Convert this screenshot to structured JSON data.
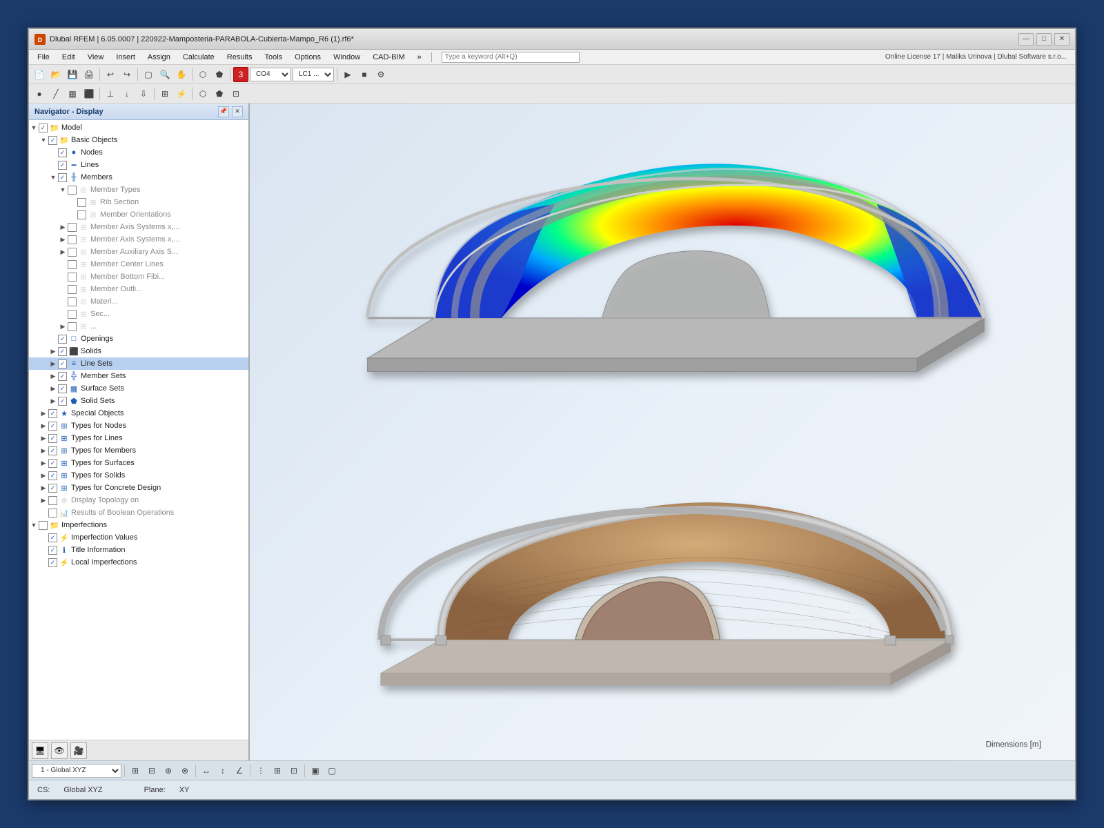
{
  "window": {
    "title": "Dlubal RFEM | 6.05.0007 | 220922-Mamposteria-PARABOLA-Cubierta-Mampo_R6 (1).rf6*",
    "app_icon": "D",
    "controls": [
      "—",
      "□",
      "✕"
    ]
  },
  "menu": {
    "items": [
      "File",
      "Edit",
      "View",
      "Insert",
      "Assign",
      "Calculate",
      "Results",
      "Tools",
      "Options",
      "Window",
      "CAD-BIM",
      "»"
    ],
    "search_placeholder": "Type a keyword (Alt+Q)",
    "license": "Online License 17 | Malika Urinova | Dlubal Software s.r.o..."
  },
  "navigator": {
    "title": "Navigator - Display",
    "tree": [
      {
        "id": "model",
        "label": "Model",
        "level": 0,
        "checked": true,
        "expanded": true,
        "hasExpander": true,
        "iconType": "folder"
      },
      {
        "id": "basic-objects",
        "label": "Basic Objects",
        "level": 1,
        "checked": true,
        "expanded": true,
        "hasExpander": true,
        "iconType": "folder"
      },
      {
        "id": "nodes",
        "label": "Nodes",
        "level": 2,
        "checked": true,
        "expanded": false,
        "hasExpander": false,
        "iconType": "node"
      },
      {
        "id": "lines",
        "label": "Lines",
        "level": 2,
        "checked": true,
        "expanded": false,
        "hasExpander": false,
        "iconType": "line"
      },
      {
        "id": "members",
        "label": "Members",
        "level": 2,
        "checked": true,
        "expanded": true,
        "hasExpander": true,
        "iconType": "member"
      },
      {
        "id": "member-types",
        "label": "Member Types",
        "level": 3,
        "checked": false,
        "expanded": true,
        "hasExpander": true,
        "iconType": "type"
      },
      {
        "id": "rib-section",
        "label": "Rib Section",
        "level": 4,
        "checked": false,
        "expanded": false,
        "hasExpander": false,
        "iconType": "type"
      },
      {
        "id": "member-orientations",
        "label": "Member Orientations",
        "level": 4,
        "checked": false,
        "expanded": false,
        "hasExpander": false,
        "iconType": "type"
      },
      {
        "id": "member-axis-x1",
        "label": "Member Axis Systems x,...",
        "level": 3,
        "checked": false,
        "expanded": false,
        "hasExpander": true,
        "iconType": "type"
      },
      {
        "id": "member-axis-x2",
        "label": "Member Axis Systems x,...",
        "level": 3,
        "checked": false,
        "expanded": false,
        "hasExpander": true,
        "iconType": "type"
      },
      {
        "id": "member-aux",
        "label": "Member Auxiliary Axis S...",
        "level": 3,
        "checked": false,
        "expanded": false,
        "hasExpander": true,
        "iconType": "type"
      },
      {
        "id": "member-center",
        "label": "Member Center Lines",
        "level": 3,
        "checked": false,
        "expanded": false,
        "hasExpander": false,
        "iconType": "type"
      },
      {
        "id": "member-bottom",
        "label": "Member Bottom Fibi...",
        "level": 3,
        "checked": false,
        "expanded": false,
        "hasExpander": false,
        "iconType": "type"
      },
      {
        "id": "member-outline",
        "label": "Member Outli...",
        "level": 3,
        "checked": false,
        "expanded": false,
        "hasExpander": false,
        "iconType": "type"
      },
      {
        "id": "materials",
        "label": "Materi...",
        "level": 3,
        "checked": false,
        "expanded": false,
        "hasExpander": false,
        "iconType": "type"
      },
      {
        "id": "sections",
        "label": "Sec...",
        "level": 3,
        "checked": false,
        "expanded": false,
        "hasExpander": false,
        "iconType": "type"
      },
      {
        "id": "surfaces-group",
        "label": "...",
        "level": 3,
        "checked": false,
        "expanded": false,
        "hasExpander": true,
        "iconType": "type"
      },
      {
        "id": "openings",
        "label": "Openings",
        "level": 2,
        "checked": true,
        "expanded": false,
        "hasExpander": false,
        "iconType": "opening"
      },
      {
        "id": "solids",
        "label": "Solids",
        "level": 2,
        "checked": true,
        "expanded": false,
        "hasExpander": true,
        "iconType": "solid"
      },
      {
        "id": "line-sets",
        "label": "Line Sets",
        "level": 2,
        "checked": true,
        "expanded": false,
        "hasExpander": true,
        "iconType": "lineset",
        "selected": true
      },
      {
        "id": "member-sets",
        "label": "Member Sets",
        "level": 2,
        "checked": true,
        "expanded": false,
        "hasExpander": true,
        "iconType": "memberset"
      },
      {
        "id": "surface-sets",
        "label": "Surface Sets",
        "level": 2,
        "checked": true,
        "expanded": false,
        "hasExpander": true,
        "iconType": "surfaceset"
      },
      {
        "id": "solid-sets",
        "label": "Solid Sets",
        "level": 2,
        "checked": true,
        "expanded": false,
        "hasExpander": true,
        "iconType": "solidset"
      },
      {
        "id": "special-objects",
        "label": "Special Objects",
        "level": 1,
        "checked": true,
        "expanded": false,
        "hasExpander": true,
        "iconType": "special"
      },
      {
        "id": "types-nodes",
        "label": "Types for Nodes",
        "level": 1,
        "checked": true,
        "expanded": false,
        "hasExpander": true,
        "iconType": "type"
      },
      {
        "id": "types-lines",
        "label": "Types for Lines",
        "level": 1,
        "checked": true,
        "expanded": false,
        "hasExpander": true,
        "iconType": "type"
      },
      {
        "id": "types-members",
        "label": "Types for Members",
        "level": 1,
        "checked": true,
        "expanded": false,
        "hasExpander": true,
        "iconType": "type"
      },
      {
        "id": "types-surfaces",
        "label": "Types for Surfaces",
        "level": 1,
        "checked": true,
        "expanded": false,
        "hasExpander": true,
        "iconType": "type"
      },
      {
        "id": "types-solids",
        "label": "Types for Solids",
        "level": 1,
        "checked": true,
        "expanded": false,
        "hasExpander": true,
        "iconType": "type"
      },
      {
        "id": "types-concrete",
        "label": "Types for Concrete Design",
        "level": 1,
        "checked": true,
        "expanded": false,
        "hasExpander": true,
        "iconType": "type"
      },
      {
        "id": "display-topology",
        "label": "Display Topology on",
        "level": 1,
        "checked": false,
        "expanded": false,
        "hasExpander": true,
        "iconType": "topology"
      },
      {
        "id": "results-boolean",
        "label": "Results of Boolean Operations",
        "level": 1,
        "checked": false,
        "expanded": false,
        "hasExpander": false,
        "iconType": "results"
      },
      {
        "id": "imperfections",
        "label": "Imperfections",
        "level": 0,
        "checked": false,
        "expanded": true,
        "hasExpander": true,
        "iconType": "folder"
      },
      {
        "id": "imperfection-values",
        "label": "Imperfection Values",
        "level": 1,
        "checked": true,
        "expanded": false,
        "hasExpander": false,
        "iconType": "imperfection"
      },
      {
        "id": "title-information",
        "label": "Title Information",
        "level": 1,
        "checked": true,
        "expanded": false,
        "hasExpander": false,
        "iconType": "info"
      },
      {
        "id": "local-imperfections",
        "label": "Local Imperfections",
        "level": 1,
        "checked": true,
        "expanded": false,
        "hasExpander": false,
        "iconType": "imperfection"
      }
    ]
  },
  "viewport": {
    "dimensions_label": "Dimensions [m]"
  },
  "status_bar": {
    "cs_label": "CS:",
    "cs_value": "Global XYZ",
    "plane_label": "Plane:",
    "plane_value": "XY"
  },
  "bottom_toolbar": {
    "coord_system": "1 - Global XYZ"
  },
  "toolbar": {
    "co4": "CO4",
    "lc1": "LC1 ..."
  }
}
